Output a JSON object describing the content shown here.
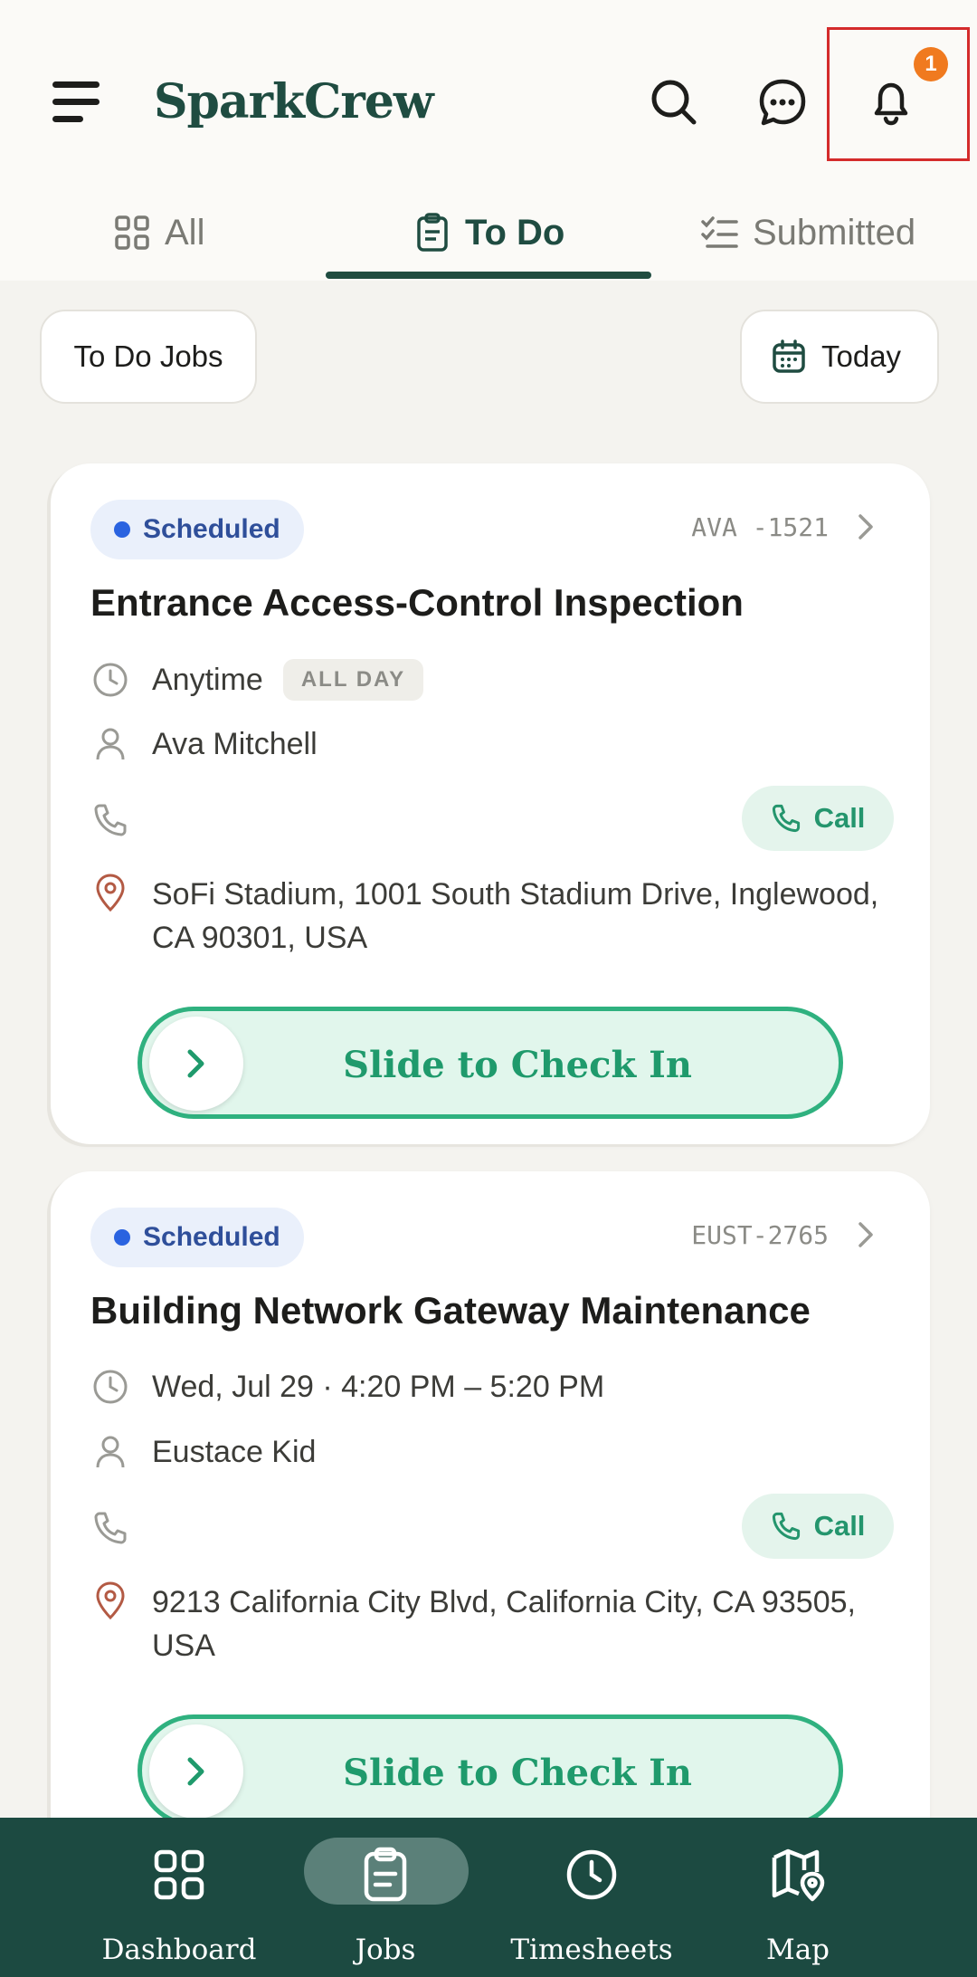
{
  "header": {
    "brand": "SparkCrew",
    "notification_count": "1"
  },
  "tabs": [
    {
      "label": "All"
    },
    {
      "label": "To Do",
      "active": true
    },
    {
      "label": "Submitted"
    }
  ],
  "filters": {
    "jobs_label": "To Do Jobs",
    "date_label": "Today"
  },
  "jobs": [
    {
      "status": "Scheduled",
      "id": "AVA -1521",
      "title": "Entrance Access-Control Inspection",
      "time": "Anytime",
      "time_badge": "ALL DAY",
      "person": "Ava Mitchell",
      "call_label": "Call",
      "address": "SoFi Stadium, 1001 South Stadium Drive, Inglewood, CA 90301, USA",
      "slider_label": "Slide to Check In"
    },
    {
      "status": "Scheduled",
      "id": "EUST-2765",
      "title": "Building Network Gateway Maintenance",
      "time": "Wed, Jul 29 · 4:20 PM – 5:20 PM",
      "person": "Eustace Kid",
      "call_label": "Call",
      "address": "9213 California City Blvd, California City, CA 93505, USA",
      "slider_label": "Slide to Check In"
    }
  ],
  "bottom_nav": [
    {
      "label": "Dashboard",
      "icon": "grid-icon"
    },
    {
      "label": "Jobs",
      "icon": "clipboard-icon",
      "active": true
    },
    {
      "label": "Timesheets",
      "icon": "clock-icon"
    },
    {
      "label": "Map",
      "icon": "map-pin-icon"
    }
  ],
  "colors": {
    "brand": "#1f4c41",
    "accent_green": "#2fb17f",
    "badge": "#f07a1f",
    "status_blue": "#2a63e0"
  }
}
